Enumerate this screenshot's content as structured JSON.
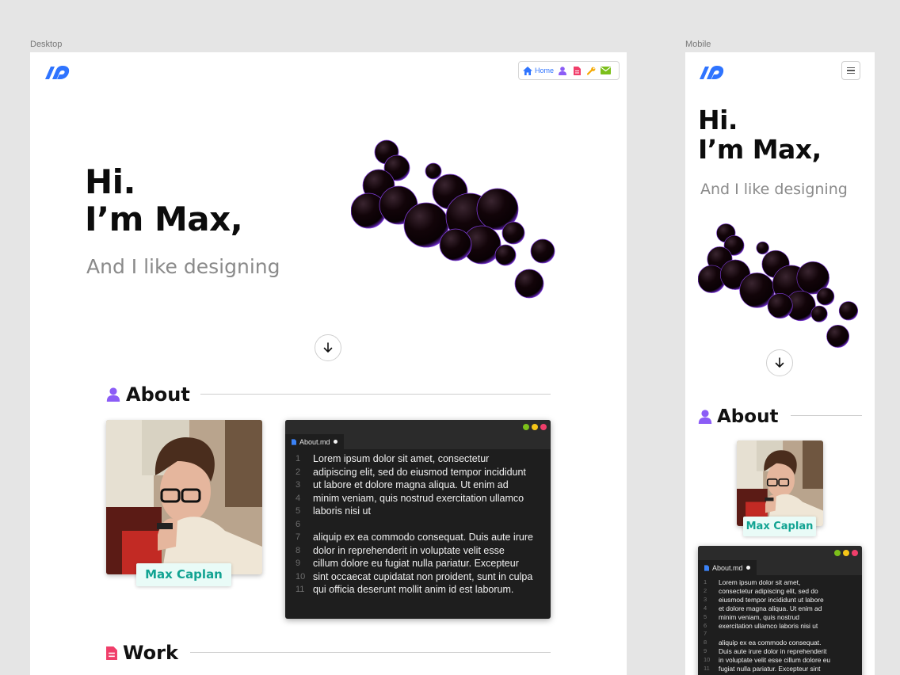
{
  "frames": {
    "desktop_label": "Desktop",
    "mobile_label": "Mobile"
  },
  "nav": {
    "items": [
      {
        "label": "Home",
        "icon": "home-icon",
        "color": "#2f74ff"
      },
      {
        "label": "",
        "icon": "user-icon",
        "color": "#8b5cf6"
      },
      {
        "label": "",
        "icon": "document-icon",
        "color": "#f03e6a"
      },
      {
        "label": "",
        "icon": "wrench-icon",
        "color": "#f5a800"
      },
      {
        "label": "",
        "icon": "mail-icon",
        "color": "#7cbf1a"
      }
    ]
  },
  "hero": {
    "line1": "Hi.",
    "line2": "I’m Max,",
    "subtitle": "And I like designing"
  },
  "about": {
    "title": "About",
    "icon": "user-icon",
    "icon_color": "#8b5cf6",
    "name": "Max Caplan"
  },
  "work": {
    "title": "Work",
    "icon": "document-icon",
    "icon_color": "#f03e6a"
  },
  "editor": {
    "filename": "About.md",
    "dot_colors": [
      "#7cbf1a",
      "#f5c518",
      "#f03e6a"
    ],
    "desktop_lines": [
      "Lorem ipsum dolor sit amet, consectetur",
      "adipiscing elit, sed do eiusmod tempor incididunt",
      "ut labore et dolore magna aliqua. Ut enim ad",
      "minim veniam, quis nostrud exercitation ullamco",
      "laboris nisi ut",
      "",
      "aliquip ex ea commodo consequat. Duis aute irure",
      "dolor in reprehenderit in voluptate velit esse",
      "cillum dolore eu fugiat nulla pariatur. Excepteur",
      "sint occaecat cupidatat non proident, sunt in culpa",
      "qui officia deserunt mollit anim id est laborum."
    ],
    "mobile_lines": [
      "Lorem ipsum dolor sit amet,",
      "consectetur adipiscing elit, sed do",
      "eiusmod tempor incididunt ut labore",
      "et dolore magna aliqua. Ut enim ad",
      "minim veniam, quis nostrud",
      "exercitation ullamco laboris nisi ut",
      "",
      "aliquip ex ea commodo consequat.",
      "Duis aute irure dolor in reprehenderit",
      "in voluptate velit esse cillum dolore eu",
      "fugiat nulla pariatur. Excepteur sint"
    ]
  },
  "colors": {
    "brand": "#2f74ff",
    "name_tag": "#11a392"
  }
}
